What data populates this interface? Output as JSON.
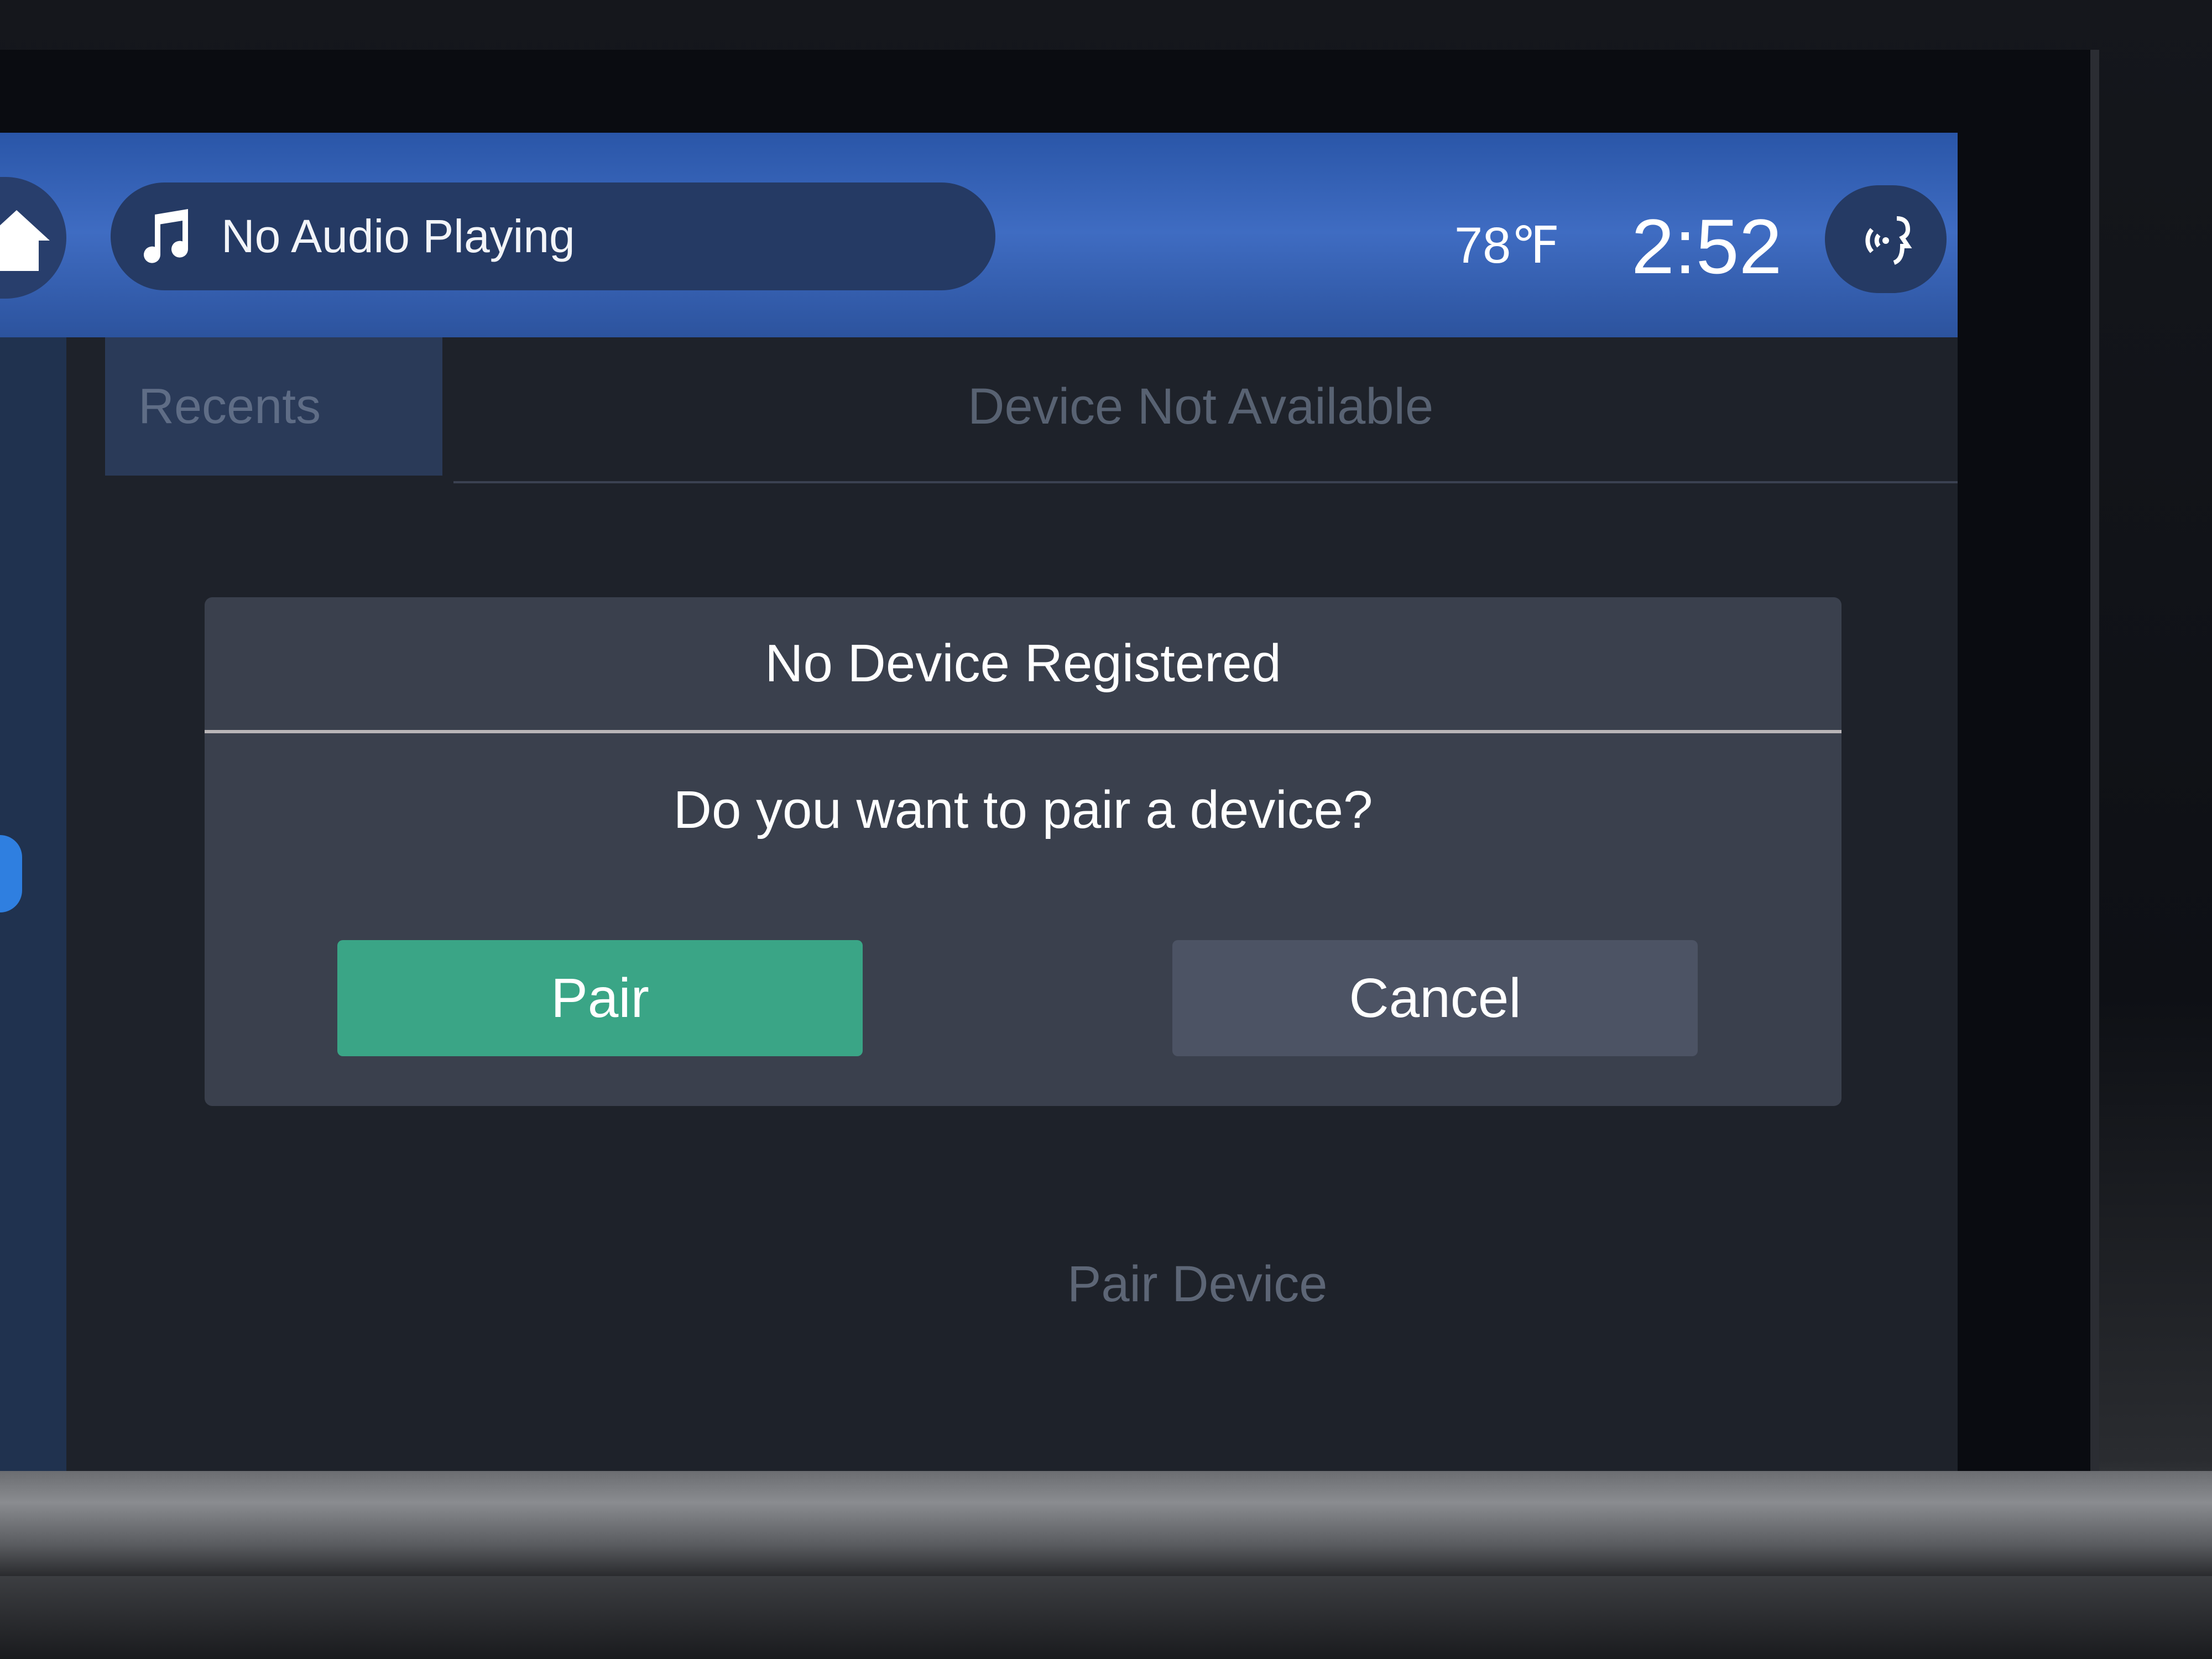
{
  "header": {
    "audio_status": "No Audio Playing",
    "temperature": "78℉",
    "time": "2:52"
  },
  "icons": {
    "home": "home-icon",
    "music": "music-note-icon",
    "voice": "voice-command-icon"
  },
  "background": {
    "tab_recents": "Recents",
    "status": "Device Not Available",
    "action": "Pair Device"
  },
  "dialog": {
    "title": "No Device Registered",
    "message": "Do you want to pair a device?",
    "confirm_label": "Pair",
    "cancel_label": "Cancel"
  },
  "colors": {
    "header_blue": "#3f6cc2",
    "pair_green": "#3aa586",
    "dialog_bg": "#3a404d"
  }
}
